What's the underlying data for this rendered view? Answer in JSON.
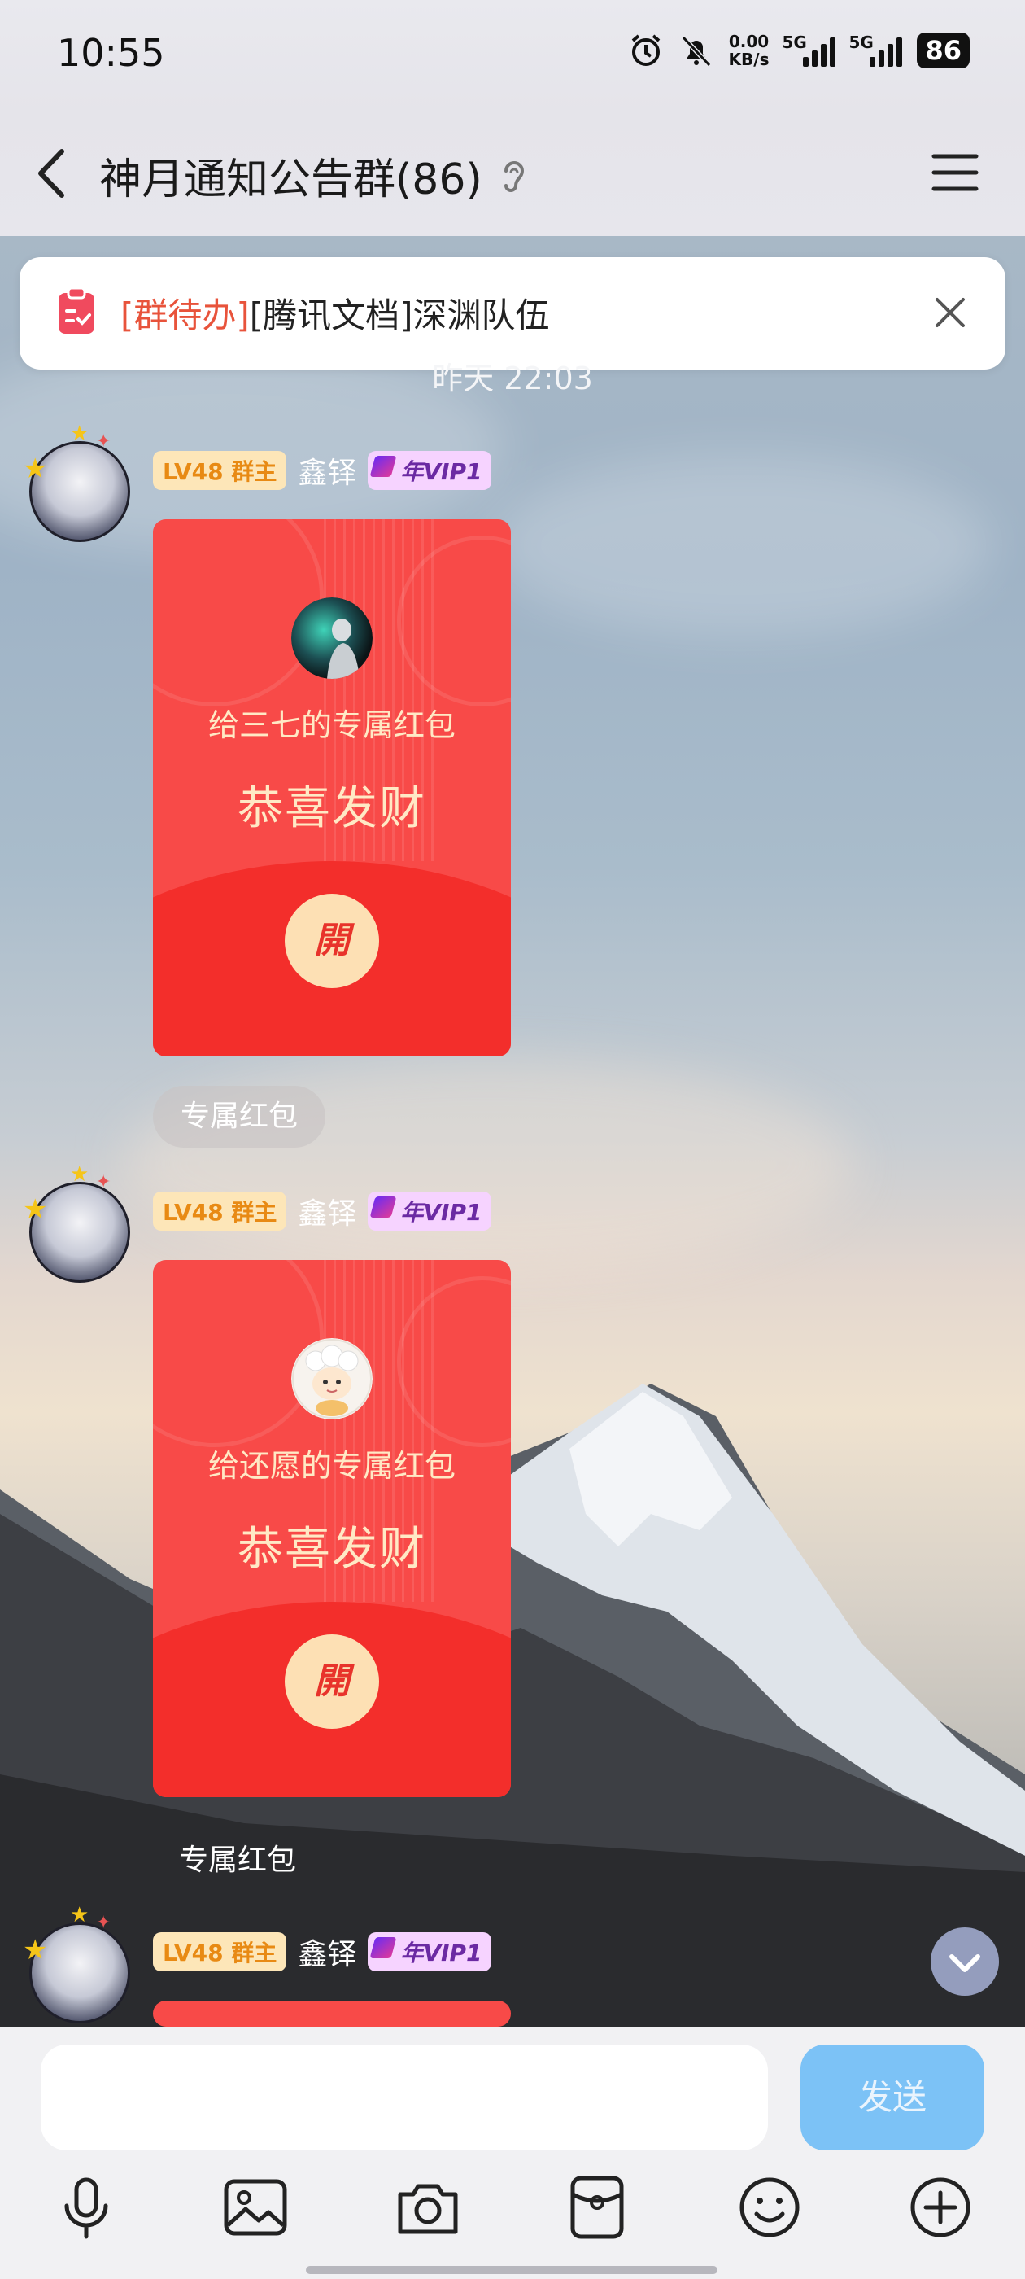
{
  "status_bar": {
    "time": "10:55",
    "net_speed_value": "0.00",
    "net_speed_unit": "KB/s",
    "signal1_label": "5G",
    "signal2_label": "5G",
    "battery": "86"
  },
  "nav": {
    "title": "神月通知公告群(86)"
  },
  "todo_banner": {
    "tag": "[群待办]",
    "text": "[腾讯文档]深渊队伍"
  },
  "timestamp": "昨天 22:03",
  "messages": [
    {
      "level_badge": "LV48 群主",
      "sender": "鑫铎",
      "vip_badge": "年VIP1",
      "packet_to": "给三七的专属红包",
      "packet_wish": "恭喜发财",
      "packet_open": "開",
      "caption": "专属红包"
    },
    {
      "level_badge": "LV48 群主",
      "sender": "鑫铎",
      "vip_badge": "年VIP1",
      "packet_to": "给还愿的专属红包",
      "packet_wish": "恭喜发财",
      "packet_open": "開",
      "caption": "专属红包"
    },
    {
      "level_badge": "LV48 群主",
      "sender": "鑫铎",
      "vip_badge": "年VIP1"
    }
  ],
  "input": {
    "text": "",
    "send_label": "发送"
  },
  "toolbar_icons": [
    "microphone-icon",
    "image-icon",
    "camera-icon",
    "red-packet-icon",
    "emoji-icon",
    "plus-icon"
  ],
  "colors": {
    "packet_red": "#f84a48",
    "packet_open_bg": "#fde0b4",
    "send_button": "#7cc2f6",
    "todo_tag": "#e8533b"
  }
}
